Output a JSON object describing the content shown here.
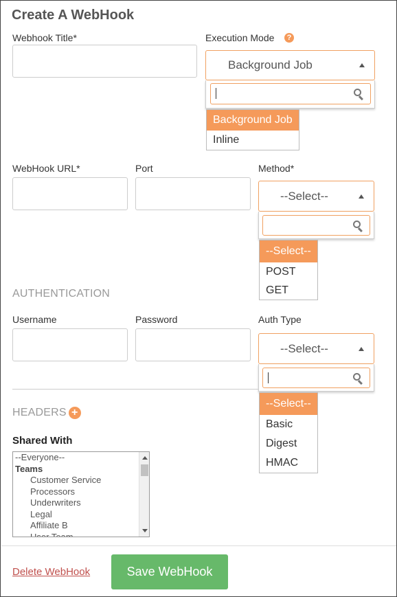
{
  "form": {
    "title": "Create A WebHook"
  },
  "webhook_title": {
    "label": "Webhook Title*",
    "value": ""
  },
  "execution_mode": {
    "label": "Execution Mode",
    "help_icon": "question-icon",
    "selected": "Background Job",
    "search_value": "",
    "options": [
      "Background Job",
      "Inline"
    ],
    "highlighted": "Background Job"
  },
  "webhook_url": {
    "label": "WebHook URL*",
    "value": ""
  },
  "port": {
    "label": "Port",
    "value": ""
  },
  "method": {
    "label": "Method*",
    "selected": "--Select--",
    "search_value": "",
    "options": [
      "--Select--",
      "POST",
      "GET"
    ],
    "highlighted": "--Select--"
  },
  "authentication": {
    "section_label": "AUTHENTICATION",
    "username": {
      "label": "Username",
      "value": ""
    },
    "password": {
      "label": "Password",
      "value": ""
    },
    "auth_type": {
      "label": "Auth Type",
      "selected": "--Select--",
      "search_value": "",
      "options": [
        "--Select--",
        "Basic",
        "Digest",
        "HMAC"
      ],
      "highlighted": "--Select--"
    }
  },
  "headers": {
    "section_label": "HEADERS",
    "add_icon": "plus-circle-icon"
  },
  "shared_with": {
    "label": "Shared With",
    "items": [
      {
        "text": "--Everyone--",
        "kind": "top"
      },
      {
        "text": "Teams",
        "kind": "group"
      },
      {
        "text": "Customer Service",
        "kind": "sub"
      },
      {
        "text": "Processors",
        "kind": "sub"
      },
      {
        "text": "Underwriters",
        "kind": "sub"
      },
      {
        "text": "Legal",
        "kind": "sub"
      },
      {
        "text": "Affiliate B",
        "kind": "sub"
      },
      {
        "text": "User Team",
        "kind": "sub"
      }
    ]
  },
  "footer": {
    "delete_label": "Delete WebHook",
    "save_label": "Save WebHook"
  },
  "colors": {
    "accent": "#f59a5a",
    "save_button": "#67b96a",
    "delete_link": "#c0504d",
    "field_focus_border": "#f0a060"
  }
}
